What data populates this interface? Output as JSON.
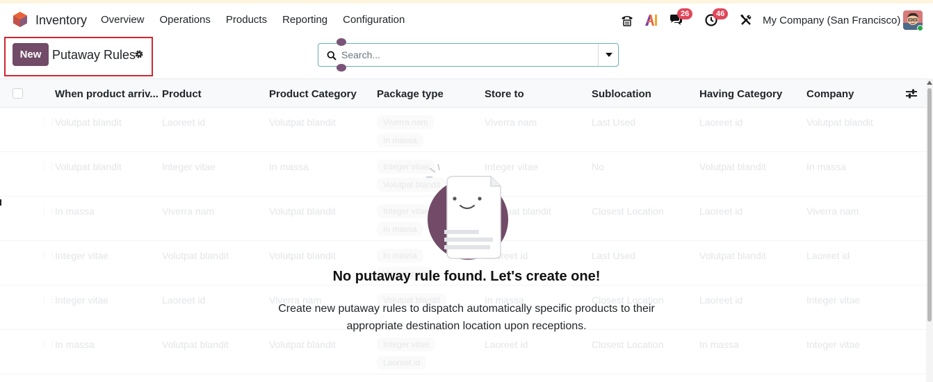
{
  "app": {
    "name": "Inventory",
    "logo_colors": [
      "#e8643b",
      "#875a7b",
      "#f5a623"
    ]
  },
  "menu": [
    {
      "label": "Overview"
    },
    {
      "label": "Operations"
    },
    {
      "label": "Products"
    },
    {
      "label": "Reporting"
    },
    {
      "label": "Configuration"
    }
  ],
  "systray": {
    "phone_icon": "phone-icon",
    "ai_icon": "ai-icon",
    "messages_count": "26",
    "activities_count": "46",
    "debug_icon": "tools-icon",
    "company": "My Company (San Francisco)"
  },
  "control_panel": {
    "new_label": "New",
    "breadcrumb": "Putaway Rules",
    "search_placeholder": "Search..."
  },
  "table": {
    "columns": [
      "When product arriv...",
      "Product",
      "Product Category",
      "Package type",
      "Store to",
      "Sublocation",
      "Having Category",
      "Company"
    ],
    "rows": [
      {
        "when": "Volutpat blandit",
        "product": "Laoreet id",
        "category": "Volutpat blandit",
        "packages": [
          "Viverra nam",
          "In massa"
        ],
        "store_to": "Viverra nam",
        "sublocation": "Last Used",
        "having": "Laoreet id",
        "company": "Volutpat blandit"
      },
      {
        "when": "Volutpat blandit",
        "product": "Integer vitae",
        "category": "In massa",
        "packages": [
          "Integer vitae",
          "Volutpat blandit"
        ],
        "store_to": "Integer vitae",
        "sublocation": "No",
        "having": "Volutpat blandit",
        "company": "In massa"
      },
      {
        "when": "In massa",
        "product": "Viverra nam",
        "category": "Volutpat blandit",
        "packages": [
          "Integer vitae",
          "In massa"
        ],
        "store_to": "Volutpat blandit",
        "sublocation": "Closest Location",
        "having": "Laoreet id",
        "company": "Viverra nam"
      },
      {
        "when": "Integer vitae",
        "product": "Volutpat blandit",
        "category": "Volutpat blandit",
        "packages": [
          "In massa",
          "Viverra nam"
        ],
        "store_to": "Laoreet id",
        "sublocation": "Last Used",
        "having": "Volutpat blandit",
        "company": "Laoreet id"
      },
      {
        "when": "Integer vitae",
        "product": "Laoreet id",
        "category": "Viverra nam",
        "packages": [
          "Volutpat blandit"
        ],
        "store_to": "In massa",
        "sublocation": "Closest Location",
        "having": "Laoreet id",
        "company": "Integer vitae"
      },
      {
        "when": "In massa",
        "product": "Volutpat blandit",
        "category": "Volutpat blandit",
        "packages": [
          "Integer vitae",
          "Laoreet id"
        ],
        "store_to": "Laoreet id",
        "sublocation": "Closest Location",
        "having": "In massa",
        "company": "Integer vitae"
      }
    ]
  },
  "empty_state": {
    "title": "No putaway rule found. Let's create one!",
    "text": "Create new putaway rules to dispatch automatically specific products to their appropriate destination location upon receptions."
  },
  "colors": {
    "primary": "#714b67",
    "highlight_border": "#d0262f",
    "badge": "#e0475a"
  }
}
